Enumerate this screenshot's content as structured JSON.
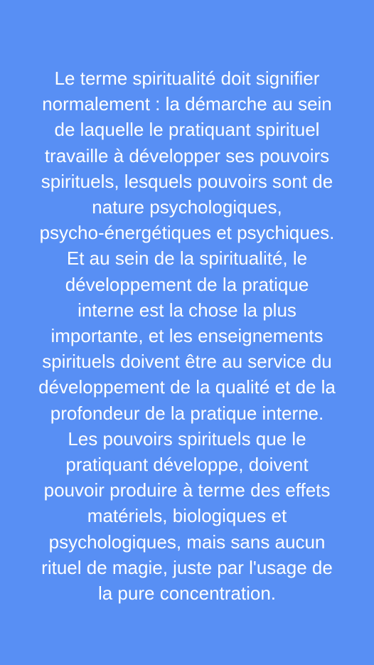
{
  "colors": {
    "background": "#588ff4",
    "text": "#ffffff"
  },
  "quote": {
    "lines": [
      "Le terme spiritualité doit signifier",
      "normalement : la démarche au sein",
      "de laquelle le pratiquant spirituel",
      "travaille à développer ses pouvoirs",
      "spirituels, lesquels pouvoirs sont de",
      "nature psychologiques,",
      "psycho-énergétiques et psychiques.",
      "Et au sein de la spiritualité, le",
      "développement de la pratique",
      "interne est la chose la plus",
      "importante, et les enseignements",
      "spirituels doivent être au service du",
      "développement de la qualité et de la",
      "profondeur de la pratique interne.",
      "Les pouvoirs spirituels que le",
      "pratiquant développe, doivent",
      "pouvoir produire à terme des effets",
      "matériels, biologiques et",
      "psychologiques, mais sans aucun",
      "rituel de magie, juste par l'usage de",
      "la pure concentration."
    ]
  }
}
